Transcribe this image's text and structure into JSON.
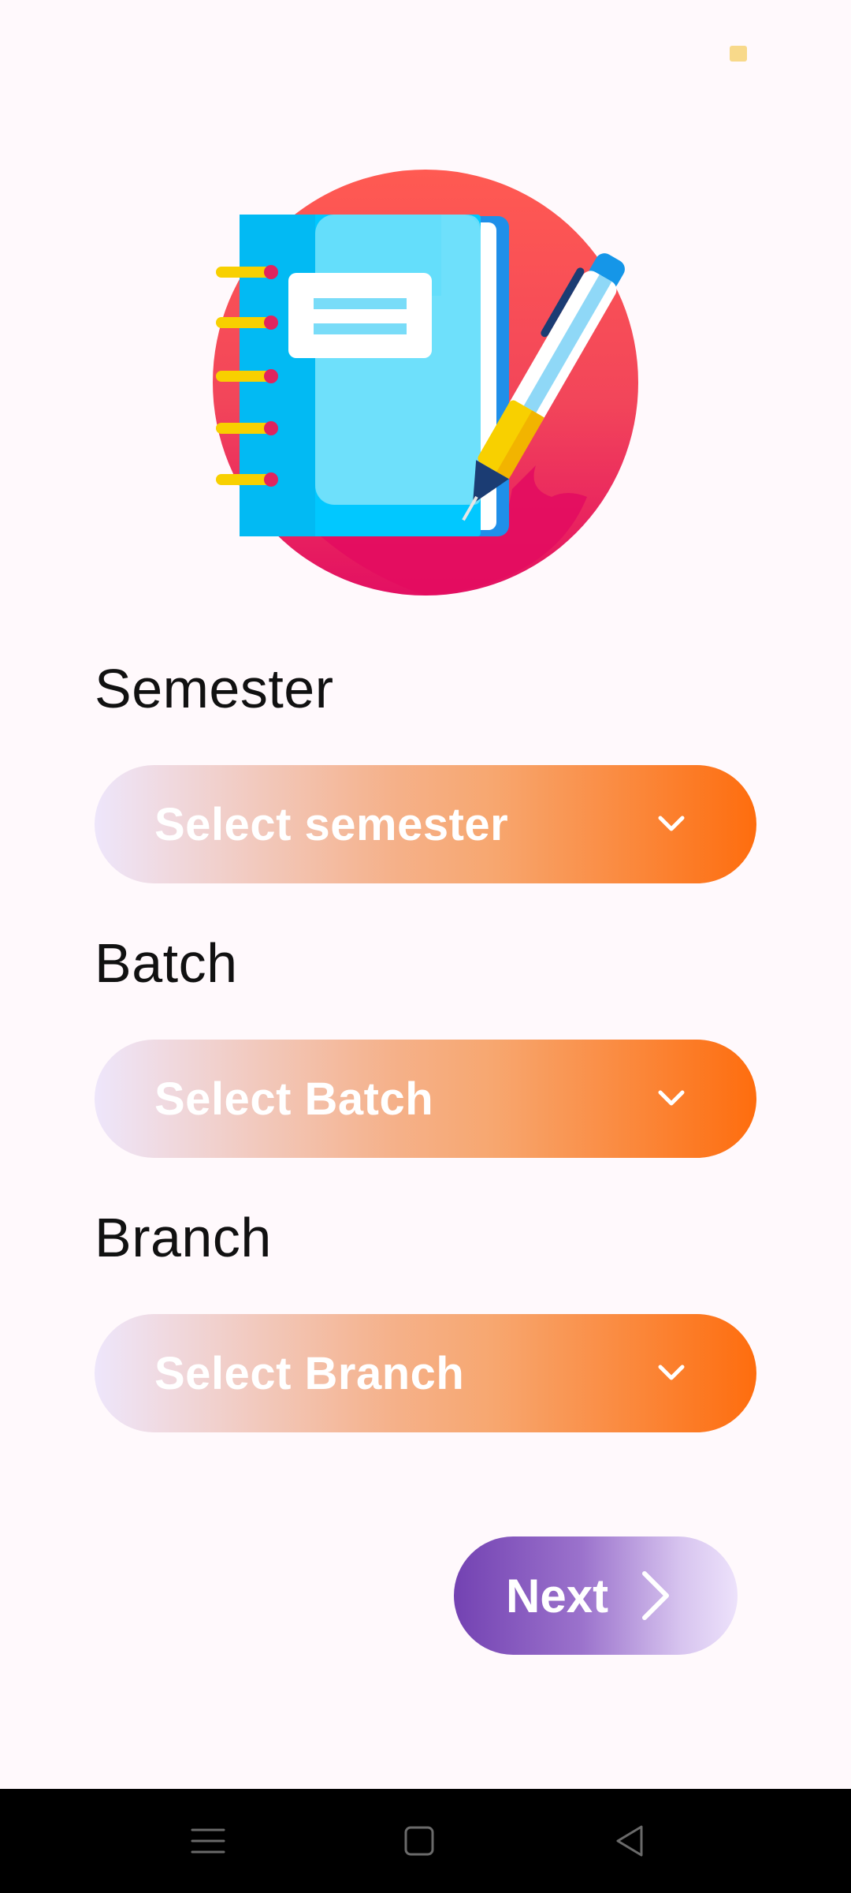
{
  "colors": {
    "background": "#fff9fc",
    "select_gradient_start": "#eee6fb",
    "select_gradient_end": "#fe6d0e",
    "next_gradient_start": "#7342b2",
    "next_gradient_end": "#ede2fb"
  },
  "hero": {
    "icon": "notebook-with-pen-illustration"
  },
  "form": {
    "semester": {
      "label": "Semester",
      "placeholder": "Select semester",
      "icon": "chevron-down-icon"
    },
    "batch": {
      "label": "Batch",
      "placeholder": "Select Batch",
      "icon": "chevron-down-icon"
    },
    "branch": {
      "label": "Branch",
      "placeholder": "Select Branch",
      "icon": "chevron-down-icon"
    }
  },
  "next_button": {
    "label": "Next",
    "icon": "chevron-right-icon"
  },
  "nav_bar": {
    "items": [
      "menu-icon",
      "home-square-icon",
      "back-triangle-icon"
    ]
  }
}
